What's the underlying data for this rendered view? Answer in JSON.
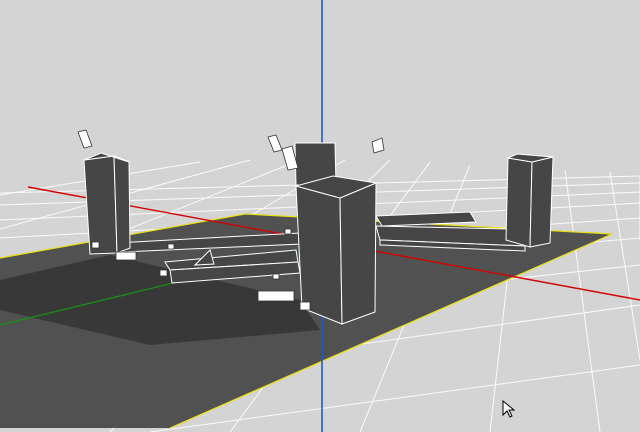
{
  "viewport": {
    "name": "3d-scene-viewport",
    "background_color": "#d4d4d4",
    "grid_color": "#ffffff",
    "ground_color": "#4a4a4a",
    "shadow_color": "#3a3a3a",
    "object_fill": "#464646",
    "object_edge_color": "#ffffff",
    "axes": {
      "x_color": "#d40000",
      "y_color": "#1a5cd8",
      "z_color": "#1b8a1b",
      "ground_border_color": "#e8e010"
    },
    "cursor_icon": "arrow-cursor-icon"
  }
}
